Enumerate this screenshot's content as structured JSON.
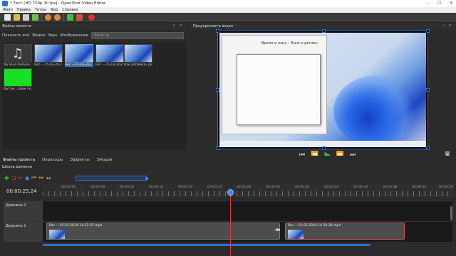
{
  "window": {
    "title": "* Тест [HD 720p 30 fps] - OpenShot Video Editor",
    "controls": [
      "–",
      "☐",
      "✕"
    ]
  },
  "menu": {
    "items": [
      "Файл",
      "Правка",
      "Титры",
      "Вид",
      "Справка"
    ]
  },
  "toolbar": {
    "icons": [
      "new-project-icon",
      "open-project-icon",
      "save-project-icon",
      "import-files-icon",
      "undo-icon",
      "redo-icon",
      "add-track-icon",
      "export-film-icon",
      "record-icon"
    ]
  },
  "project_files": {
    "title": "Файлы проекта",
    "filters": [
      "Показать всё",
      "Видео",
      "Звук",
      "Изображение"
    ],
    "filter_placeholder": "Фильтр",
    "items": [
      {
        "caption": "My Blue Heaven...",
        "kind": "music"
      },
      {
        "caption": "Rec ---15-03-202...",
        "kind": "video"
      },
      {
        "caption": "Rec ---15-03-202...",
        "kind": "video"
      },
      {
        "caption": "Rec ---15-03-202...",
        "kind": "video"
      },
      {
        "caption": "Как добавить де...",
        "kind": "video"
      },
      {
        "caption": "Футаж „Лайк по...",
        "kind": "green"
      }
    ]
  },
  "preview": {
    "title": "Предпросмотр видео",
    "window_heading": "Время и язык  ›  Язык и регион",
    "controls": [
      "⏮",
      "⏪",
      "▶",
      "⏩",
      "⏭"
    ]
  },
  "tabs": [
    "Файлы проекта",
    "Переходы",
    "Эффекты",
    "Эмодзи"
  ],
  "timeline": {
    "title": "Шкала времени",
    "current_time": "00:00:25,24",
    "ruler_labels": [
      "00:00:04",
      "00:00:08",
      "00:00:12",
      "00:00:16",
      "00:00:20",
      "00:00:24",
      "00:00:28",
      "00:00:32",
      "00:00:36",
      "00:00:40",
      "00:00:44",
      "00:00:48",
      "00:00:52",
      "00:00:56"
    ],
    "tracks": [
      {
        "name": "Дорожка 2",
        "clips": []
      },
      {
        "name": "Дорожка 1",
        "clips": [
          {
            "title": "Rec ---15-03-2024-14-32-55.mp4"
          },
          {
            "title": "Rec ---15-03-2024-14-36-28.mp4"
          }
        ]
      }
    ]
  },
  "colors": {
    "accent": "#2d6fd1",
    "playhead": "#e03b3b",
    "green_footage": "#18e023"
  }
}
